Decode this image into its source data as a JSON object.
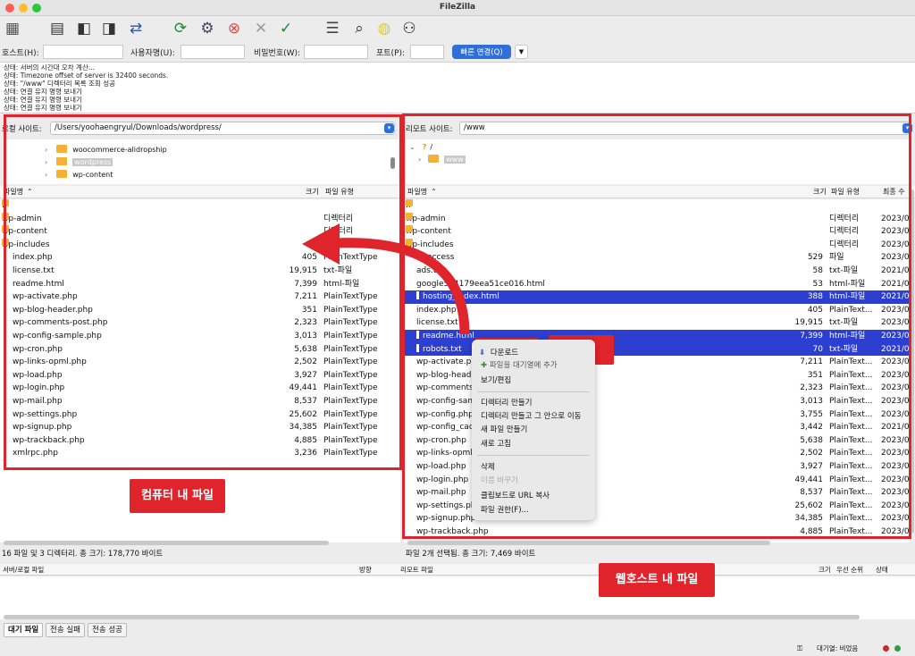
{
  "window": {
    "title": "FileZilla"
  },
  "toolbar": {
    "icons": [
      "site-manager-icon",
      "toggle-log-icon",
      "toggle-local-tree-icon",
      "toggle-remote-tree-icon",
      "toggle-queue-icon",
      "refresh-icon",
      "process-queue-icon",
      "cancel-icon",
      "disconnect-icon",
      "reconnect-icon",
      "filter-icon",
      "compare-icon",
      "sync-icon",
      "search-icon"
    ]
  },
  "quickconnect": {
    "host_label": "호스트(H):",
    "user_label": "사용자명(U):",
    "pass_label": "비밀번호(W):",
    "port_label": "포트(P):",
    "connect_label": "빠른 연결(Q)"
  },
  "log": [
    "상태:  서버의 시간대 오차 계산...",
    "상태:  Timezone offset of server is 32400 seconds.",
    "상태:  \"/www\" 디렉터리 목록 조회 성공",
    "상태:  연결 유지 명령 보내기",
    "상태:  연결 유지 명령 보내기",
    "상태:  연결 유지 명령 보내기"
  ],
  "local": {
    "site_label": "로컬 사이트:",
    "path": "/Users/yoohaengryul/Downloads/wordpress/",
    "tree": [
      {
        "name": "woocommerce-alidropship",
        "selected": false
      },
      {
        "name": "wordpress",
        "selected": true
      },
      {
        "name": "wp-content",
        "selected": false
      }
    ],
    "columns": {
      "name": "파일명",
      "size": "크기",
      "type": "파일 유형"
    },
    "files": [
      {
        "name": "..",
        "size": "",
        "type": "",
        "folder": true
      },
      {
        "name": "wp-admin",
        "size": "",
        "type": "디렉터리",
        "folder": true
      },
      {
        "name": "wp-content",
        "size": "",
        "type": "디렉터리",
        "folder": true
      },
      {
        "name": "wp-includes",
        "size": "",
        "type": "디렉터리",
        "folder": true
      },
      {
        "name": "index.php",
        "size": "405",
        "type": "PlainTextType"
      },
      {
        "name": "license.txt",
        "size": "19,915",
        "type": "txt-파일"
      },
      {
        "name": "readme.html",
        "size": "7,399",
        "type": "html-파일"
      },
      {
        "name": "wp-activate.php",
        "size": "7,211",
        "type": "PlainTextType"
      },
      {
        "name": "wp-blog-header.php",
        "size": "351",
        "type": "PlainTextType"
      },
      {
        "name": "wp-comments-post.php",
        "size": "2,323",
        "type": "PlainTextType"
      },
      {
        "name": "wp-config-sample.php",
        "size": "3,013",
        "type": "PlainTextType"
      },
      {
        "name": "wp-cron.php",
        "size": "5,638",
        "type": "PlainTextType"
      },
      {
        "name": "wp-links-opml.php",
        "size": "2,502",
        "type": "PlainTextType"
      },
      {
        "name": "wp-load.php",
        "size": "3,927",
        "type": "PlainTextType"
      },
      {
        "name": "wp-login.php",
        "size": "49,441",
        "type": "PlainTextType"
      },
      {
        "name": "wp-mail.php",
        "size": "8,537",
        "type": "PlainTextType"
      },
      {
        "name": "wp-settings.php",
        "size": "25,602",
        "type": "PlainTextType"
      },
      {
        "name": "wp-signup.php",
        "size": "34,385",
        "type": "PlainTextType"
      },
      {
        "name": "wp-trackback.php",
        "size": "4,885",
        "type": "PlainTextType"
      },
      {
        "name": "xmlrpc.php",
        "size": "3,236",
        "type": "PlainTextType"
      }
    ],
    "status": "16 파일 및 3 디렉터리. 총 크기: 178,770 바이트"
  },
  "remote": {
    "site_label": "리모트 사이트:",
    "path": "/www",
    "tree": [
      {
        "name": "/",
        "selected": false
      },
      {
        "name": "www",
        "selected": true
      }
    ],
    "columns": {
      "name": "파일명",
      "size": "크기",
      "type": "파일 유형",
      "modified": "최종 수"
    },
    "files": [
      {
        "name": "..",
        "size": "",
        "type": "",
        "date": "",
        "folder": true,
        "selected": false
      },
      {
        "name": "wp-admin",
        "size": "",
        "type": "디렉터리",
        "date": "2023/0",
        "folder": true,
        "selected": false
      },
      {
        "name": "wp-content",
        "size": "",
        "type": "디렉터리",
        "date": "2023/0",
        "folder": true,
        "selected": false
      },
      {
        "name": "wp-includes",
        "size": "",
        "type": "디렉터리",
        "date": "2023/0",
        "folder": true,
        "selected": false
      },
      {
        "name": ".htaccess",
        "size": "529",
        "type": "파일",
        "date": "2023/0",
        "selected": false
      },
      {
        "name": "ads.txt",
        "size": "58",
        "type": "txt-파일",
        "date": "2021/0",
        "selected": false
      },
      {
        "name": "google544179eea51ce016.html",
        "size": "53",
        "type": "html-파일",
        "date": "2021/0",
        "selected": false
      },
      {
        "name": "hosting_index.html",
        "size": "388",
        "type": "html-파일",
        "date": "2021/0",
        "selected": true
      },
      {
        "name": "index.php",
        "size": "405",
        "type": "PlainText...",
        "date": "2023/0",
        "selected": false
      },
      {
        "name": "license.txt",
        "size": "19,915",
        "type": "txt-파일",
        "date": "2023/0",
        "selected": false
      },
      {
        "name": "readme.html",
        "size": "7,399",
        "type": "html-파일",
        "date": "2023/0",
        "selected": true
      },
      {
        "name": "robots.txt",
        "size": "70",
        "type": "txt-파일",
        "date": "2021/0",
        "selected": true
      },
      {
        "name": "wp-activate.php",
        "size": "7,211",
        "type": "PlainText...",
        "date": "2023/0",
        "selected": false
      },
      {
        "name": "wp-blog-header.php",
        "size": "351",
        "type": "PlainText...",
        "date": "2023/0",
        "selected": false
      },
      {
        "name": "wp-comments-post.php",
        "size": "2,323",
        "type": "PlainText...",
        "date": "2023/0",
        "selected": false
      },
      {
        "name": "wp-config-sample.php",
        "size": "3,013",
        "type": "PlainText...",
        "date": "2023/0",
        "selected": false
      },
      {
        "name": "wp-config.php",
        "size": "3,755",
        "type": "PlainText...",
        "date": "2023/0",
        "selected": false
      },
      {
        "name": "wp-config_cache.php",
        "size": "3,442",
        "type": "PlainText...",
        "date": "2021/0",
        "selected": false
      },
      {
        "name": "wp-cron.php",
        "size": "5,638",
        "type": "PlainText...",
        "date": "2023/0",
        "selected": false
      },
      {
        "name": "wp-links-opml.php",
        "size": "2,502",
        "type": "PlainText...",
        "date": "2023/0",
        "selected": false
      },
      {
        "name": "wp-load.php",
        "size": "3,927",
        "type": "PlainText...",
        "date": "2023/0",
        "selected": false
      },
      {
        "name": "wp-login.php",
        "size": "49,441",
        "type": "PlainText...",
        "date": "2023/0",
        "selected": false
      },
      {
        "name": "wp-mail.php",
        "size": "8,537",
        "type": "PlainText...",
        "date": "2023/0",
        "selected": false
      },
      {
        "name": "wp-settings.php",
        "size": "25,602",
        "type": "PlainText...",
        "date": "2023/0",
        "selected": false
      },
      {
        "name": "wp-signup.php",
        "size": "34,385",
        "type": "PlainText...",
        "date": "2023/0",
        "selected": false
      },
      {
        "name": "wp-trackback.php",
        "size": "4,885",
        "type": "PlainText...",
        "date": "2023/0",
        "selected": false
      }
    ],
    "status": "파일 2개 선택됨. 총 크기: 7,469 바이트"
  },
  "context_menu": {
    "download": "다운로드",
    "add_queue": "파일을 대기열에 추가",
    "view_edit": "보기/편집",
    "mkdir": "디렉터리 만들기",
    "mkdir_enter": "디렉터리 만들고 그 안으로 이동",
    "new_file": "새 파일 만들기",
    "refresh": "새로 고침",
    "delete": "삭제",
    "rename": "이름 바꾸기",
    "copy_url": "클립보드로 URL 복사",
    "permissions": "파일 권한(F)..."
  },
  "queue": {
    "columns": {
      "local": "서버/로컬 파일",
      "direction": "방향",
      "remote": "리모트 파일",
      "size": "크기",
      "priority": "우선 순위",
      "status": "상태"
    },
    "tabs": [
      "대기 파일",
      "전송 실패",
      "전송 성공"
    ]
  },
  "footer": {
    "queue_status": "대기열: 비었음"
  },
  "annotations": {
    "local_label": "컴퓨터 내 파일",
    "remote_label": "웹호스트 내 파일",
    "click_label": "클릭"
  },
  "colors": {
    "accent": "#2f6fd8",
    "selection": "#2d3fd0",
    "annotation": "#e0242c",
    "folder": "#f3b235"
  }
}
